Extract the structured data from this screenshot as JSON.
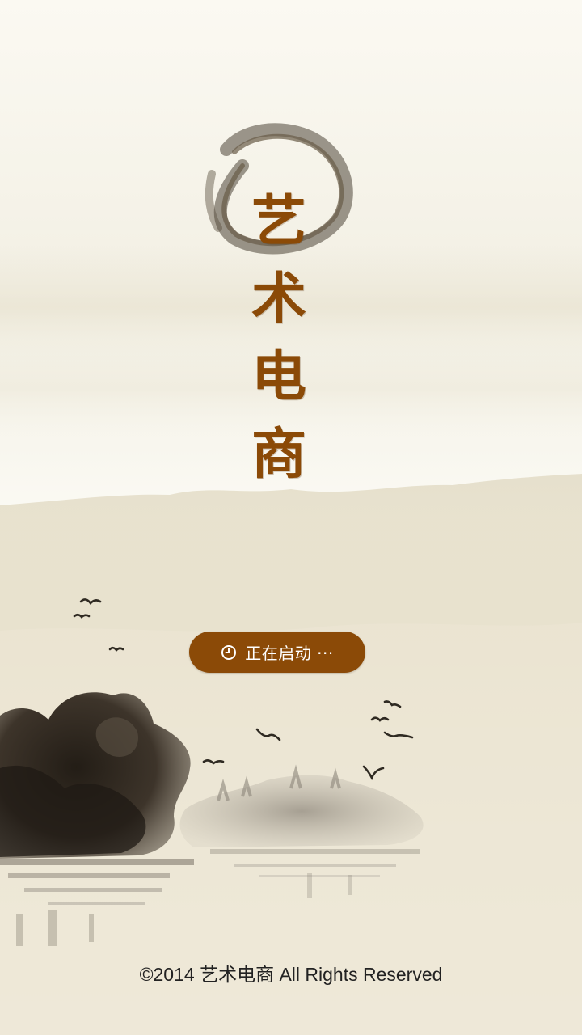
{
  "app": {
    "title_chars": [
      "艺",
      "术",
      "电",
      "商"
    ]
  },
  "loading": {
    "icon": "clock-icon",
    "label": "正在启动 ···"
  },
  "footer": {
    "copyright": "©2014  艺术电商 All Rights Reserved"
  },
  "colors": {
    "accent": "#8b4a07",
    "text_dark": "#222222",
    "ink": "#2f2a22",
    "paper": "#f3efe2"
  }
}
